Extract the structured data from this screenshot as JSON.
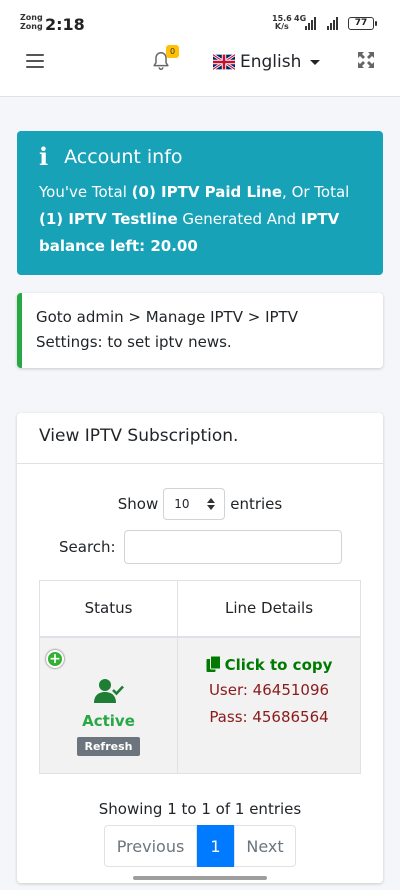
{
  "status_bar": {
    "carrier_1": "Zong",
    "carrier_2": "Zong",
    "time": "2:18",
    "net_speed_value": "15.6",
    "net_speed_unit": "K/s",
    "network_type": "4G",
    "battery": "77"
  },
  "navbar": {
    "notification_count": "0",
    "language_label": "English",
    "icons": [
      "menu-icon",
      "bell-icon",
      "uk-flag-icon",
      "expand-icon"
    ],
    "badge_color": "#ffc107"
  },
  "account_info": {
    "title": "Account info",
    "line_1_pre": "You've Total ",
    "paid_count": "(0) IPTV Paid Line",
    "line_1_mid": ", Or Total",
    "test_count": "(1) IPTV Testline",
    "line_2_mid": " Generated And ",
    "balance_label": "IPTV balance left: 20.00",
    "color": "#17a2b8"
  },
  "news": {
    "text": "Goto admin > Manage IPTV > IPTV Settings: to set iptv news."
  },
  "subscription": {
    "title": "View IPTV Subscription.",
    "show_label": "Show",
    "entries_value": "10",
    "entries_label": "entries",
    "search_label": "Search:",
    "search_value": "",
    "columns": [
      "Status",
      "Line Details"
    ],
    "rows": [
      {
        "status": "Active",
        "refresh_label": "Refresh",
        "copy_label": "Click to copy",
        "user": "User: 46451096",
        "pass": "Pass: 45686564"
      }
    ],
    "info": "Showing 1 to 1 of 1 entries",
    "pagination": {
      "previous": "Previous",
      "current": "1",
      "next": "Next"
    },
    "colors": {
      "active": "#28a745",
      "copy": "#007a00",
      "credentials": "#8b1a1a",
      "page_current": "#007bff"
    }
  }
}
